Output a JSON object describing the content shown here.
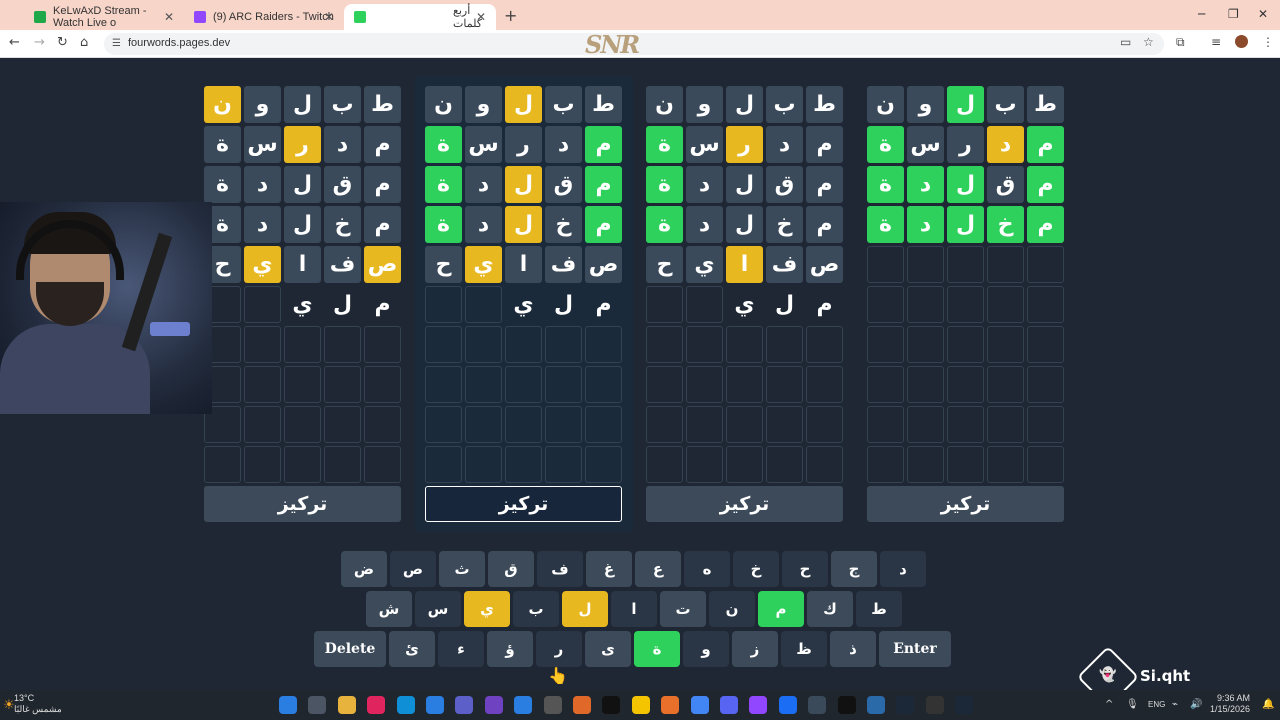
{
  "browser": {
    "tabs": [
      {
        "title": "KeLwAxD Stream - Watch Live o",
        "favicon_color": "#1fa84a"
      },
      {
        "title": "(9) ARC Raiders - Twitch",
        "favicon_color": "#9146ff"
      },
      {
        "title": "أربع كلمات",
        "favicon_color": "#2ed15c"
      }
    ],
    "new_tab": "+",
    "window_buttons": {
      "minimize": "─",
      "restore": "❐",
      "close": "✕"
    },
    "url": "fourwords.pages.dev",
    "watermark": "SNR"
  },
  "boards": [
    {
      "rows": [
        [
          {
            "l": "ن",
            "s": "y"
          },
          {
            "l": "و",
            "s": "f"
          },
          {
            "l": "ل",
            "s": "f"
          },
          {
            "l": "ب",
            "s": "f"
          },
          {
            "l": "ط",
            "s": "f"
          }
        ],
        [
          {
            "l": "ة",
            "s": "f"
          },
          {
            "l": "س",
            "s": "f"
          },
          {
            "l": "ر",
            "s": "y"
          },
          {
            "l": "د",
            "s": "f"
          },
          {
            "l": "م",
            "s": "f"
          }
        ],
        [
          {
            "l": "ة",
            "s": "f"
          },
          {
            "l": "د",
            "s": "f"
          },
          {
            "l": "ل",
            "s": "f"
          },
          {
            "l": "ق",
            "s": "f"
          },
          {
            "l": "م",
            "s": "f"
          }
        ],
        [
          {
            "l": "ة",
            "s": "f"
          },
          {
            "l": "د",
            "s": "f"
          },
          {
            "l": "ل",
            "s": "f"
          },
          {
            "l": "خ",
            "s": "f"
          },
          {
            "l": "م",
            "s": "f"
          }
        ],
        [
          {
            "l": "ح",
            "s": "f"
          },
          {
            "l": "ي",
            "s": "y"
          },
          {
            "l": "ا",
            "s": "f"
          },
          {
            "l": "ف",
            "s": "f"
          },
          {
            "l": "ص",
            "s": "y"
          }
        ],
        [
          {
            "l": "",
            "s": "e"
          },
          {
            "l": "",
            "s": "e"
          },
          {
            "l": "ي",
            "s": "p"
          },
          {
            "l": "ل",
            "s": "p"
          },
          {
            "l": "م",
            "s": "p"
          }
        ]
      ],
      "focus_label": "تركيز",
      "selected": false
    },
    {
      "rows": [
        [
          {
            "l": "ن",
            "s": "f"
          },
          {
            "l": "و",
            "s": "f"
          },
          {
            "l": "ل",
            "s": "y"
          },
          {
            "l": "ب",
            "s": "f"
          },
          {
            "l": "ط",
            "s": "f"
          }
        ],
        [
          {
            "l": "ة",
            "s": "g"
          },
          {
            "l": "س",
            "s": "f"
          },
          {
            "l": "ر",
            "s": "f"
          },
          {
            "l": "د",
            "s": "f"
          },
          {
            "l": "م",
            "s": "g"
          }
        ],
        [
          {
            "l": "ة",
            "s": "g"
          },
          {
            "l": "د",
            "s": "f"
          },
          {
            "l": "ل",
            "s": "y"
          },
          {
            "l": "ق",
            "s": "f"
          },
          {
            "l": "م",
            "s": "g"
          }
        ],
        [
          {
            "l": "ة",
            "s": "g"
          },
          {
            "l": "د",
            "s": "f"
          },
          {
            "l": "ل",
            "s": "y"
          },
          {
            "l": "خ",
            "s": "f"
          },
          {
            "l": "م",
            "s": "g"
          }
        ],
        [
          {
            "l": "ح",
            "s": "f"
          },
          {
            "l": "ي",
            "s": "y"
          },
          {
            "l": "ا",
            "s": "f"
          },
          {
            "l": "ف",
            "s": "f"
          },
          {
            "l": "ص",
            "s": "f"
          }
        ],
        [
          {
            "l": "",
            "s": "e"
          },
          {
            "l": "",
            "s": "e"
          },
          {
            "l": "ي",
            "s": "p"
          },
          {
            "l": "ل",
            "s": "p"
          },
          {
            "l": "م",
            "s": "p"
          }
        ]
      ],
      "focus_label": "تركيز",
      "selected": true
    },
    {
      "rows": [
        [
          {
            "l": "ن",
            "s": "f"
          },
          {
            "l": "و",
            "s": "f"
          },
          {
            "l": "ل",
            "s": "f"
          },
          {
            "l": "ب",
            "s": "f"
          },
          {
            "l": "ط",
            "s": "f"
          }
        ],
        [
          {
            "l": "ة",
            "s": "g"
          },
          {
            "l": "س",
            "s": "f"
          },
          {
            "l": "ر",
            "s": "y"
          },
          {
            "l": "د",
            "s": "f"
          },
          {
            "l": "م",
            "s": "f"
          }
        ],
        [
          {
            "l": "ة",
            "s": "g"
          },
          {
            "l": "د",
            "s": "f"
          },
          {
            "l": "ل",
            "s": "f"
          },
          {
            "l": "ق",
            "s": "f"
          },
          {
            "l": "م",
            "s": "f"
          }
        ],
        [
          {
            "l": "ة",
            "s": "g"
          },
          {
            "l": "د",
            "s": "f"
          },
          {
            "l": "ل",
            "s": "f"
          },
          {
            "l": "خ",
            "s": "f"
          },
          {
            "l": "م",
            "s": "f"
          }
        ],
        [
          {
            "l": "ح",
            "s": "f"
          },
          {
            "l": "ي",
            "s": "f"
          },
          {
            "l": "ا",
            "s": "y"
          },
          {
            "l": "ف",
            "s": "f"
          },
          {
            "l": "ص",
            "s": "f"
          }
        ],
        [
          {
            "l": "",
            "s": "e"
          },
          {
            "l": "",
            "s": "e"
          },
          {
            "l": "ي",
            "s": "p"
          },
          {
            "l": "ل",
            "s": "p"
          },
          {
            "l": "م",
            "s": "p"
          }
        ]
      ],
      "focus_label": "تركيز",
      "selected": false
    },
    {
      "rows": [
        [
          {
            "l": "ن",
            "s": "f"
          },
          {
            "l": "و",
            "s": "f"
          },
          {
            "l": "ل",
            "s": "g"
          },
          {
            "l": "ب",
            "s": "f"
          },
          {
            "l": "ط",
            "s": "f"
          }
        ],
        [
          {
            "l": "ة",
            "s": "g"
          },
          {
            "l": "س",
            "s": "f"
          },
          {
            "l": "ر",
            "s": "f"
          },
          {
            "l": "د",
            "s": "y"
          },
          {
            "l": "م",
            "s": "g"
          }
        ],
        [
          {
            "l": "ة",
            "s": "g"
          },
          {
            "l": "د",
            "s": "g"
          },
          {
            "l": "ل",
            "s": "g"
          },
          {
            "l": "ق",
            "s": "f"
          },
          {
            "l": "م",
            "s": "g"
          }
        ],
        [
          {
            "l": "ة",
            "s": "g"
          },
          {
            "l": "د",
            "s": "g"
          },
          {
            "l": "ل",
            "s": "g"
          },
          {
            "l": "خ",
            "s": "g"
          },
          {
            "l": "م",
            "s": "g"
          }
        ]
      ],
      "focus_label": "تركيز",
      "selected": false
    }
  ],
  "keyboard": {
    "rows": [
      [
        {
          "k": "ض",
          "s": "f"
        },
        {
          "k": "ص",
          "s": "p"
        },
        {
          "k": "ث",
          "s": "f"
        },
        {
          "k": "ق",
          "s": "f"
        },
        {
          "k": "ف",
          "s": "p"
        },
        {
          "k": "غ",
          "s": "f"
        },
        {
          "k": "ع",
          "s": "f"
        },
        {
          "k": "ه",
          "s": "p"
        },
        {
          "k": "خ",
          "s": "p"
        },
        {
          "k": "ح",
          "s": "p"
        },
        {
          "k": "ج",
          "s": "f"
        },
        {
          "k": "د",
          "s": "p"
        }
      ],
      [
        {
          "k": "ش",
          "s": "f"
        },
        {
          "k": "س",
          "s": "p"
        },
        {
          "k": "ي",
          "s": "y"
        },
        {
          "k": "ب",
          "s": "p"
        },
        {
          "k": "ل",
          "s": "y"
        },
        {
          "k": "ا",
          "s": "p"
        },
        {
          "k": "ت",
          "s": "f"
        },
        {
          "k": "ن",
          "s": "p"
        },
        {
          "k": "م",
          "s": "g"
        },
        {
          "k": "ك",
          "s": "f"
        },
        {
          "k": "ط",
          "s": "p"
        }
      ],
      [
        {
          "k": "Delete",
          "s": "f"
        },
        {
          "k": "ئ",
          "s": "f"
        },
        {
          "k": "ء",
          "s": "p"
        },
        {
          "k": "ؤ",
          "s": "f"
        },
        {
          "k": "ر",
          "s": "p"
        },
        {
          "k": "ى",
          "s": "f"
        },
        {
          "k": "ة",
          "s": "g"
        },
        {
          "k": "و",
          "s": "p"
        },
        {
          "k": "ز",
          "s": "f"
        },
        {
          "k": "ظ",
          "s": "p"
        },
        {
          "k": "ذ",
          "s": "f"
        },
        {
          "k": "Enter",
          "s": "f"
        }
      ]
    ]
  },
  "stream": {
    "name": "Si.qht"
  },
  "taskbar": {
    "weather_temp": "13°C",
    "weather_desc": "مشمس غالبًا",
    "lang": "ENG",
    "time": "9:36 AM",
    "date": "1/15/2026"
  }
}
